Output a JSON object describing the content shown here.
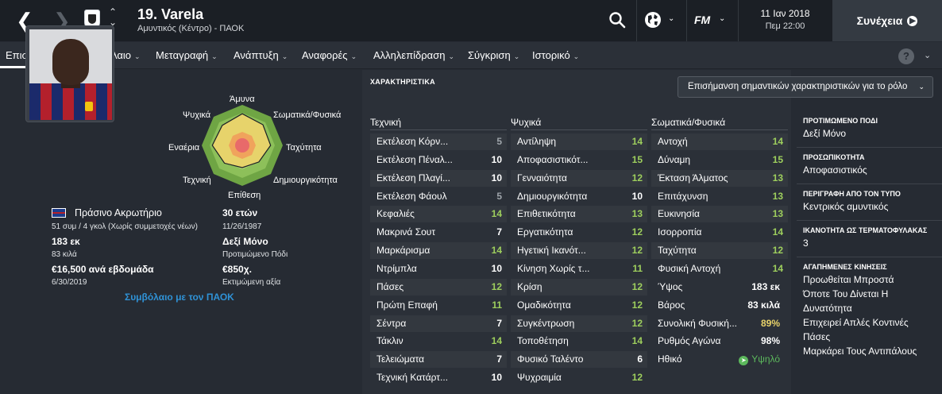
{
  "header": {
    "player_title": "19. Varela",
    "player_subtitle": "Αμυντικός (Κέντρο) - ΠΑΟΚ",
    "date": "11 Ιαν 2018",
    "time": "Πεμ 22:00",
    "continue_label": "Συνέχεια",
    "fm_logo": "FM"
  },
  "icons": [
    "back-arrow-icon",
    "forward-arrow-icon",
    "club-crest-icon",
    "up-down-chevron-icon",
    "search-icon",
    "globe-icon",
    "chevron-down-icon",
    "fm-logo-icon",
    "play-circle-icon",
    "help-icon",
    "footstep-icon"
  ],
  "tabs": [
    {
      "label": "Επισκόπηση"
    },
    {
      "label": "Συμβόλαιο"
    },
    {
      "label": "Μεταγραφή"
    },
    {
      "label": "Ανάπτυξη"
    },
    {
      "label": "Αναφορές"
    },
    {
      "label": "Αλληλεπίδραση"
    },
    {
      "label": "Σύγκριση"
    },
    {
      "label": "Ιστορικό"
    }
  ],
  "help_label": "?",
  "radar": {
    "labels": {
      "defence": "Άμυνα",
      "physical": "Σωματικά/Φυσικά",
      "speed": "Ταχύτητα",
      "creativity": "Δημιουργικότητα",
      "attack": "Επίθεση",
      "technical": "Τεχνική",
      "aerial": "Εναέρια",
      "mental": "Ψυχικά"
    },
    "values": [
      0.78,
      0.72,
      0.7,
      0.58,
      0.55,
      0.62,
      0.74,
      0.7
    ]
  },
  "profile": {
    "nationality": "Πράσινο Ακρωτήριο",
    "caps": "51 συμ / 4 γκολ (Χωρίς συμμετοχές νέων)",
    "height": "183 εκ",
    "weight": "83 κιλά",
    "wage": "€16,500 ανά εβδομάδα",
    "contract_end": "6/30/2019",
    "age": "30 ετών",
    "dob": "11/26/1987",
    "foot": "Δεξί Μόνο",
    "foot_caption": "Προτιμώμενο Πόδι",
    "value": "€850χ.",
    "value_caption": "Εκτιμώμενη αξία",
    "contract_link": "Συμβόλαιο με τον ΠΑΟΚ"
  },
  "attributes": {
    "section_title": "ΧΑΡΑΚΤΗΡΙΣΤΙΚΑ",
    "highlight_dropdown": "Επισήμανση σημαντικών χαρακτηριστικών για το ρόλο",
    "technical": {
      "title": "Τεχνική",
      "rows": [
        {
          "name": "Εκτέλεση Κόρν...",
          "value": "5",
          "tone": "gr"
        },
        {
          "name": "Εκτέλεση Πέναλ...",
          "value": "10",
          "tone": "w"
        },
        {
          "name": "Εκτέλεση Πλαγί...",
          "value": "10",
          "tone": "w"
        },
        {
          "name": "Εκτέλεση Φάουλ",
          "value": "5",
          "tone": "gr"
        },
        {
          "name": "Κεφαλιές",
          "value": "14",
          "tone": "g"
        },
        {
          "name": "Μακρινά Σουτ",
          "value": "7",
          "tone": "w"
        },
        {
          "name": "Μαρκάρισμα",
          "value": "14",
          "tone": "g"
        },
        {
          "name": "Ντρίμπλα",
          "value": "10",
          "tone": "w"
        },
        {
          "name": "Πάσες",
          "value": "12",
          "tone": "g"
        },
        {
          "name": "Πρώτη Επαφή",
          "value": "11",
          "tone": "g"
        },
        {
          "name": "Σέντρα",
          "value": "7",
          "tone": "w"
        },
        {
          "name": "Τάκλιν",
          "value": "14",
          "tone": "g"
        },
        {
          "name": "Τελειώματα",
          "value": "7",
          "tone": "w"
        },
        {
          "name": "Τεχνική Κατάρτ...",
          "value": "10",
          "tone": "w"
        }
      ]
    },
    "mental": {
      "title": "Ψυχικά",
      "rows": [
        {
          "name": "Αντίληψη",
          "value": "14",
          "tone": "g"
        },
        {
          "name": "Αποφασιστικότ...",
          "value": "15",
          "tone": "g"
        },
        {
          "name": "Γενναιότητα",
          "value": "12",
          "tone": "g"
        },
        {
          "name": "Δημιουργικότητα",
          "value": "10",
          "tone": "w"
        },
        {
          "name": "Επιθετικότητα",
          "value": "13",
          "tone": "g"
        },
        {
          "name": "Εργατικότητα",
          "value": "12",
          "tone": "g"
        },
        {
          "name": "Ηγετική Ικανότ...",
          "value": "12",
          "tone": "g"
        },
        {
          "name": "Κίνηση Χωρίς τ...",
          "value": "11",
          "tone": "g"
        },
        {
          "name": "Κρίση",
          "value": "12",
          "tone": "g"
        },
        {
          "name": "Ομαδικότητα",
          "value": "12",
          "tone": "g"
        },
        {
          "name": "Συγκέντρωση",
          "value": "12",
          "tone": "g"
        },
        {
          "name": "Τοποθέτηση",
          "value": "14",
          "tone": "g"
        },
        {
          "name": "Φυσικό Ταλέντο",
          "value": "6",
          "tone": "w"
        },
        {
          "name": "Ψυχραιμία",
          "value": "12",
          "tone": "g"
        }
      ]
    },
    "physical": {
      "title": "Σωματικά/Φυσικά",
      "rows": [
        {
          "name": "Αντοχή",
          "value": "14",
          "tone": "g"
        },
        {
          "name": "Δύναμη",
          "value": "15",
          "tone": "g"
        },
        {
          "name": "Έκταση Άλματος",
          "value": "13",
          "tone": "g"
        },
        {
          "name": "Επιτάχυνση",
          "value": "13",
          "tone": "g"
        },
        {
          "name": "Ευκινησία",
          "value": "13",
          "tone": "g"
        },
        {
          "name": "Ισορροπία",
          "value": "14",
          "tone": "g"
        },
        {
          "name": "Ταχύτητα",
          "value": "12",
          "tone": "g"
        },
        {
          "name": "Φυσική Αντοχή",
          "value": "14",
          "tone": "g"
        }
      ],
      "extra": [
        {
          "name": "Ύψος",
          "value": "183 εκ",
          "tone": "w"
        },
        {
          "name": "Βάρος",
          "value": "83 κιλά",
          "tone": "w"
        },
        {
          "name": "Συνολική Φυσική...",
          "value": "89%",
          "tone": "y"
        },
        {
          "name": "Ρυθμός Αγώνα",
          "value": "98%",
          "tone": "w"
        },
        {
          "name": "Ηθικό",
          "value": "Υψηλό",
          "tone": "g"
        }
      ]
    }
  },
  "side_info": [
    {
      "heading": "ΠΡΟΤΙΜΩΜΕΝΟ ΠΟΔΙ",
      "lines": [
        "Δεξί Μόνο"
      ]
    },
    {
      "heading": "ΠΡΟΣΩΠΙΚΟΤΗΤΑ",
      "lines": [
        "Αποφασιστικός"
      ]
    },
    {
      "heading": "ΠΕΡΙΓΡΑΦΗ ΑΠΟ ΤΟΝ ΤΥΠΟ",
      "lines": [
        "Κεντρικός αμυντικός"
      ]
    },
    {
      "heading": "ΙΚΑΝΟΤΗΤΑ ΩΣ ΤΕΡΜΑΤΟΦΥΛΑΚΑΣ",
      "lines": [
        "3"
      ]
    },
    {
      "heading": "ΑΓΑΠΗΜΕΝΕΣ ΚΙΝΗΣΕΙΣ",
      "lines": [
        "Προωθείται Μπροστά",
        "Όποτε Του Δίνεται Η",
        "Δυνατότητα",
        "Επιχειρεί Απλές Κοντινές",
        "Πάσες",
        "Μαρκάρει Τους Αντιπάλους"
      ]
    }
  ],
  "colors": {
    "accent_green": "#9ecf5d",
    "link_blue": "#2f92d6",
    "morale_green": "#5cb85c",
    "percent_yellow": "#e9d36a"
  }
}
